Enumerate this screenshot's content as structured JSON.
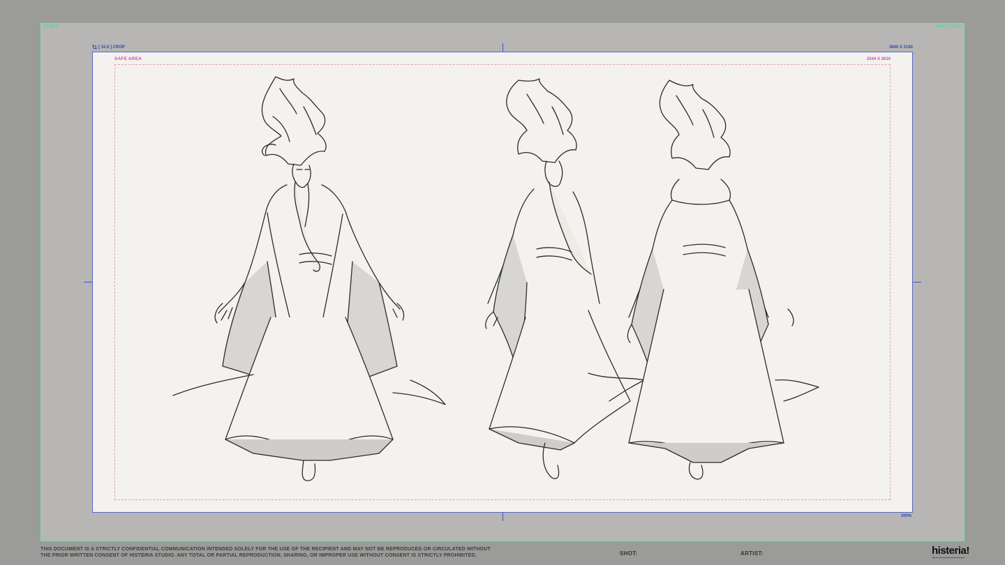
{
  "frame": {
    "bleed_label_left": "BLEED",
    "bleed_label_right": "3840 X 2160",
    "crop_label": "[ 10.0 ] CROP",
    "resolution_label": "3840 X 2160",
    "zoom_label": "100%",
    "safe_area_label": "SAFE AREA",
    "safe_area_resolution": "2044 X 3634"
  },
  "icons": {
    "crop": "crop-icon"
  },
  "colors": {
    "bleed_outline": "#7fd9b7",
    "crop_outline": "#5567c9",
    "safe_area": "#d04fb7",
    "canvas": "#f4f2ee"
  },
  "artwork": {
    "views": [
      "front",
      "three-quarter",
      "back"
    ]
  },
  "footer": {
    "legal_line1": "THIS DOCUMENT IS A STRICTLY CONFIDENTIAL COMMUNICATION INTENDED SOLELY FOR THE USE OF THE RECIPIENT AND MAY NOT BE REPRODUCED OR CIRCULATED WITHOUT",
    "legal_line2": "THE PRIOR WRITTEN CONSENT OF HISTERIA STUDIO. ANY TOTAL OR PARTIAL REPRODUCTION, SHARING, OR IMPROPER USE WITHOUT CONSENT IS STRICTLY PROHIBITED.",
    "shot_label": "SHOT:",
    "artist_label": "ARTIST:",
    "brand": "histeria!"
  }
}
